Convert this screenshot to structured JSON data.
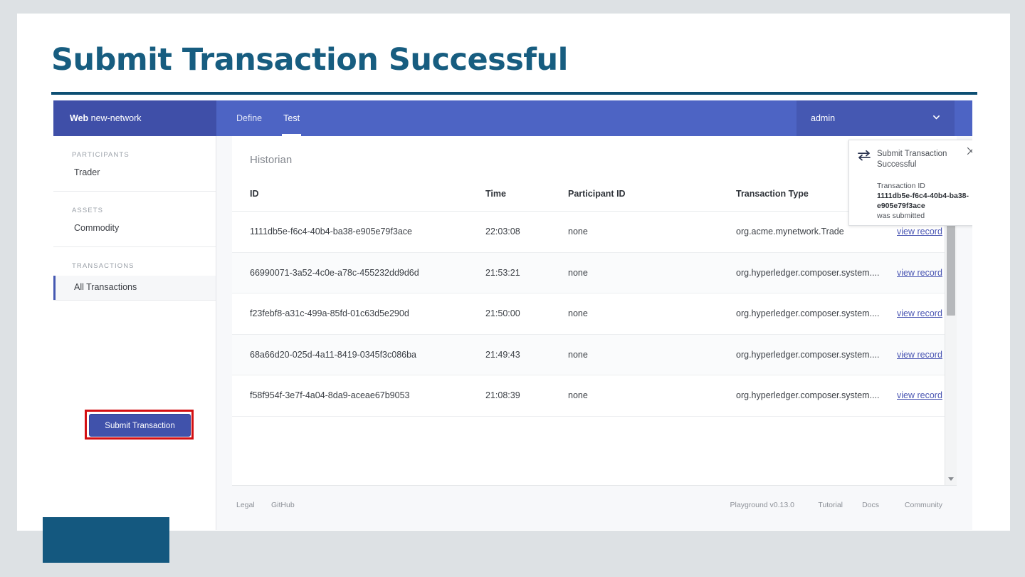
{
  "slide": {
    "title": "Submit Transaction Successful"
  },
  "app": {
    "navbar": {
      "brand_strong": "Web",
      "brand_rest": " new-network",
      "tabs": [
        {
          "label": "Define",
          "active": false
        },
        {
          "label": "Test",
          "active": true
        }
      ],
      "user": "admin",
      "user_chevron_icon": "chevron-down-icon"
    },
    "sidebar": {
      "groups": [
        {
          "heading": "PARTICIPANTS",
          "items": [
            {
              "label": "Trader",
              "selected": false
            }
          ]
        },
        {
          "heading": "ASSETS",
          "items": [
            {
              "label": "Commodity",
              "selected": false
            }
          ]
        },
        {
          "heading": "TRANSACTIONS",
          "items": [
            {
              "label": "All Transactions",
              "selected": true
            }
          ]
        }
      ],
      "submit_button": "Submit Transaction",
      "annotation_color": "#d30f12"
    },
    "main": {
      "card_title": "Historian",
      "columns": [
        "ID",
        "Time",
        "Participant ID",
        "Transaction Type"
      ],
      "link_label": "view record",
      "rows": [
        {
          "id": "1111db5e-f6c4-40b4-ba38-e905e79f3ace",
          "time": "22:03:08",
          "participant": "none",
          "type": "org.acme.mynetwork.Trade",
          "link": "view record"
        },
        {
          "id": "66990071-3a52-4c0e-a78c-455232dd9d6d",
          "time": "21:53:21",
          "participant": "none",
          "type": "org.hyperledger.composer.system....",
          "link": "view record"
        },
        {
          "id": "f23febf8-a31c-499a-85fd-01c63d5e290d",
          "time": "21:50:00",
          "participant": "none",
          "type": "org.hyperledger.composer.system....",
          "link": "view record"
        },
        {
          "id": "68a66d20-025d-4a11-8419-0345f3c086ba",
          "time": "21:49:43",
          "participant": "none",
          "type": "org.hyperledger.composer.system....",
          "link": "view record"
        },
        {
          "id": "f58f954f-3e7f-4a04-8da9-aceae67b9053",
          "time": "21:08:39",
          "participant": "none",
          "type": "org.hyperledger.composer.system....",
          "link": "view record"
        }
      ]
    },
    "toast": {
      "icon": "transfer-arrows-icon",
      "title": "Submit Transaction Successful",
      "body_prefix": "Transaction ID",
      "transaction_id": "1111db5e-f6c4-40b4-ba38-e905e79f3ace",
      "body_suffix": "was submitted",
      "close_icon": "close-icon"
    },
    "footer": {
      "left": [
        "Legal",
        "GitHub"
      ],
      "right": [
        "Playground v0.13.0",
        "Tutorial",
        "Docs",
        "Community"
      ]
    },
    "scrollbar": {
      "up_icon": "scroll-up-arrow-icon",
      "down_icon": "scroll-down-arrow-icon"
    }
  },
  "colors": {
    "title": "#175d80",
    "rule": "#0d4f73",
    "nav": "#4d64c4",
    "brand": "#3f4fa8",
    "accent_button": "#4052ab",
    "annotation": "#d30f12",
    "link": "#4a56b3"
  }
}
